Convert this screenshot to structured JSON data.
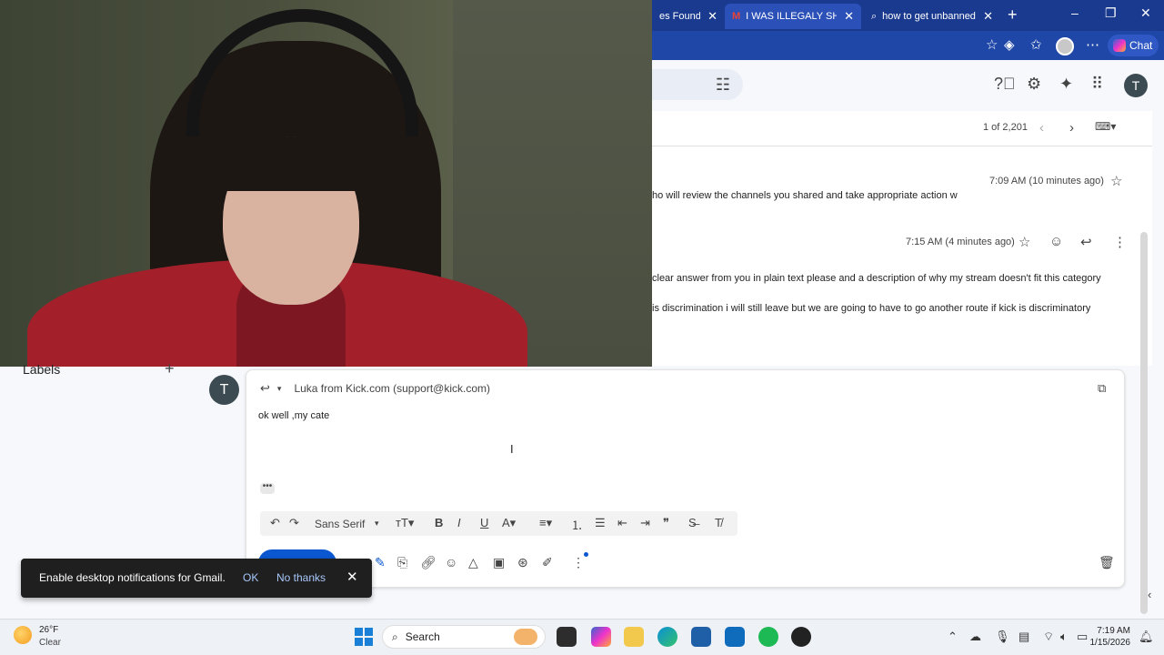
{
  "browser": {
    "tabs": [
      {
        "label": "es Found",
        "active": false
      },
      {
        "label": "I WAS ILLEGALY SHADO",
        "active": true
      },
      {
        "label": "how to get unbanned fr",
        "active": false
      }
    ],
    "chat_label": "Chat"
  },
  "mail": {
    "pager": "1 of 2,201",
    "message1": {
      "snippet": "ho will review the channels you shared and take appropriate action w",
      "time": "7:09 AM (10 minutes ago)"
    },
    "message2": {
      "time": "7:15 AM (4 minutes ago)",
      "line1": "clear answer from you in plain text please and a description of why my stream doesn't fit this category",
      "line2": "is discrimination i will still leave but  we are going to have to go another route if kick is discriminatory"
    }
  },
  "user": {
    "initial": "T"
  },
  "sidebar": {
    "labels_title": "Labels",
    "add_symbol": "+"
  },
  "compose": {
    "recipient": "Luka from Kick.com (support@kick.com)",
    "body": "ok well ,my cate",
    "toolbar": {
      "font": "Sans Serif"
    }
  },
  "toast": {
    "message": "Enable desktop notifications for Gmail.",
    "ok": "OK",
    "no_thanks": "No thanks"
  },
  "taskbar": {
    "weather_temp": "26°F",
    "weather_desc": "Clear",
    "search_label": "Search",
    "time": "7:19 AM",
    "date": "1/15/2026"
  },
  "colors": {
    "accent": "#0b57d0",
    "browser_chrome": "#1a3a8f",
    "webcam_shirt": "#a3202b"
  }
}
